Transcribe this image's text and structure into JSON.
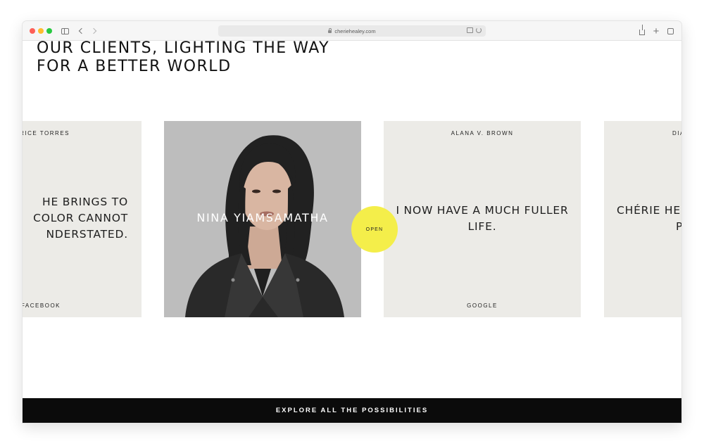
{
  "browser": {
    "url": "cheriehealey.com"
  },
  "section": {
    "heading_line1": "OUR CLIENTS, LIGHTING THE WAY",
    "heading_line2": "FOR A BETTER WORLD"
  },
  "cards": [
    {
      "name": "ERICE TORRES",
      "quote_lines": [
        "HE BRINGS TO",
        "COLOR CANNOT",
        "NDERSTATED."
      ],
      "company": "FACEBOOK"
    },
    {
      "name": "NINA YIAMSAMATHA",
      "photo": true
    },
    {
      "name": "ALANA V. BROWN",
      "quote_lines": [
        "I NOW HAVE A MUCH FULLER",
        "LIFE."
      ],
      "company": "GOOGLE"
    },
    {
      "name": "DIA",
      "quote_lines": [
        "CHÉRIE HE",
        "PU"
      ]
    }
  ],
  "open_button": {
    "label": "OPEN",
    "color": "#f4ee4a"
  },
  "footer": {
    "cta_label": "EXPLORE ALL THE POSSIBILITIES"
  }
}
